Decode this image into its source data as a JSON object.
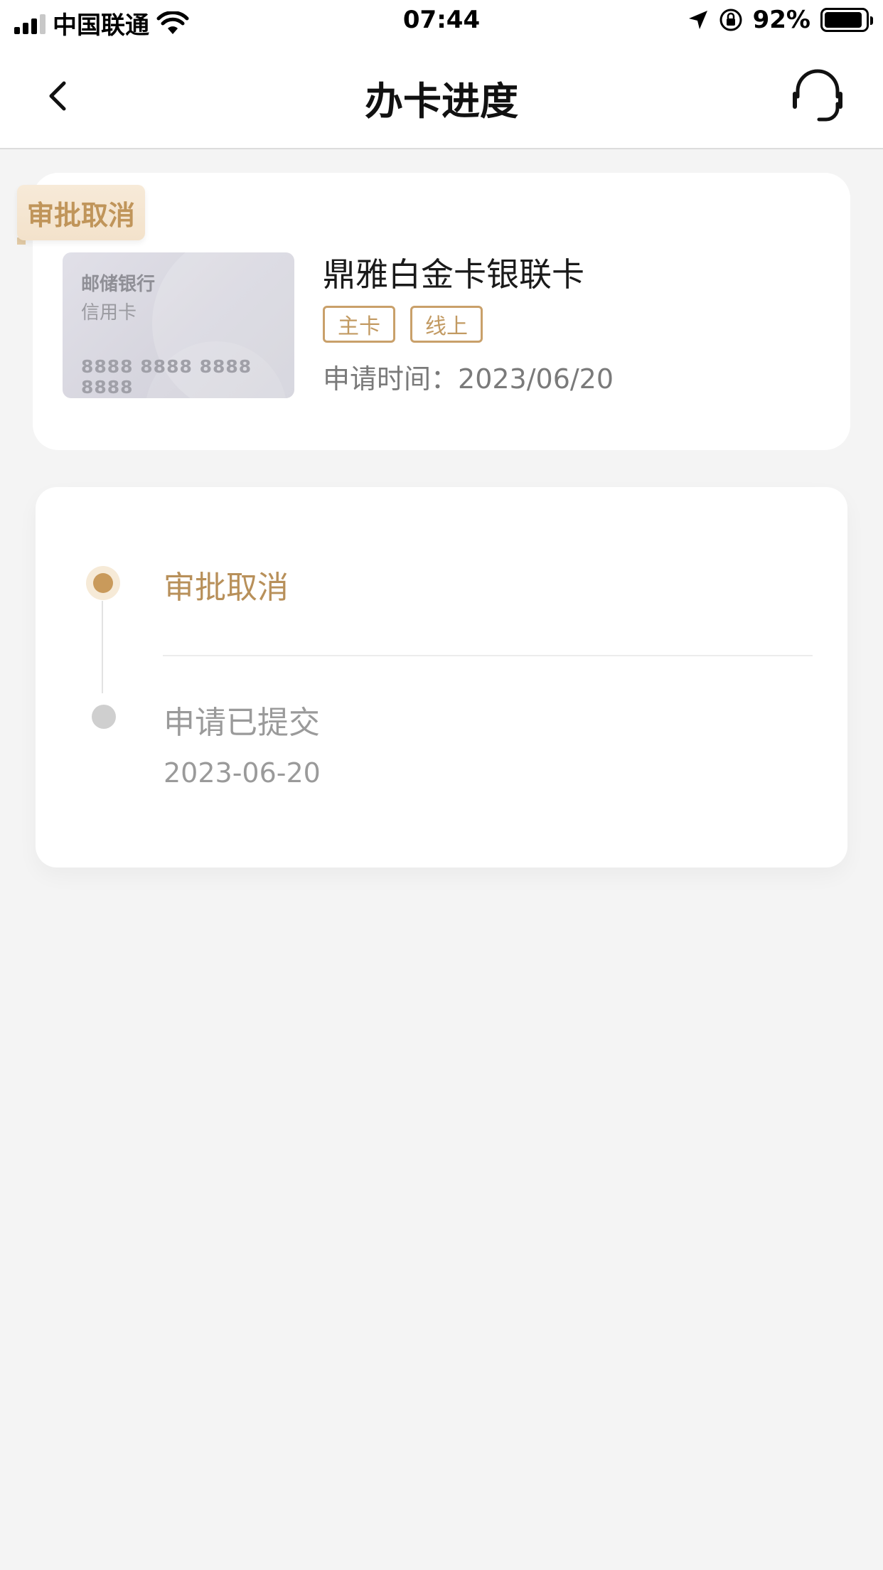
{
  "status_bar": {
    "carrier": "中国联通",
    "time": "07:44",
    "battery_percent": "92%",
    "battery_level": 0.92
  },
  "header": {
    "title": "办卡进度",
    "back_icon": "chevron-left-icon",
    "service_icon": "headset-icon"
  },
  "card": {
    "status_tag": "审批取消",
    "image": {
      "bank": "邮储银行",
      "type": "信用卡",
      "number": "8888 8888 8888 8888"
    },
    "name": "鼎雅白金卡银联卡",
    "badges": [
      "主卡",
      "线上"
    ],
    "apply_time_label": "申请时间：",
    "apply_time": "2023/06/20"
  },
  "progress": {
    "steps": [
      {
        "title": "审批取消",
        "date": "",
        "active": true
      },
      {
        "title": "申请已提交",
        "date": "2023-06-20",
        "active": false
      }
    ]
  },
  "colors": {
    "accent": "#c99a5b",
    "accent_text": "#b8905a",
    "background": "#f4f4f4"
  }
}
